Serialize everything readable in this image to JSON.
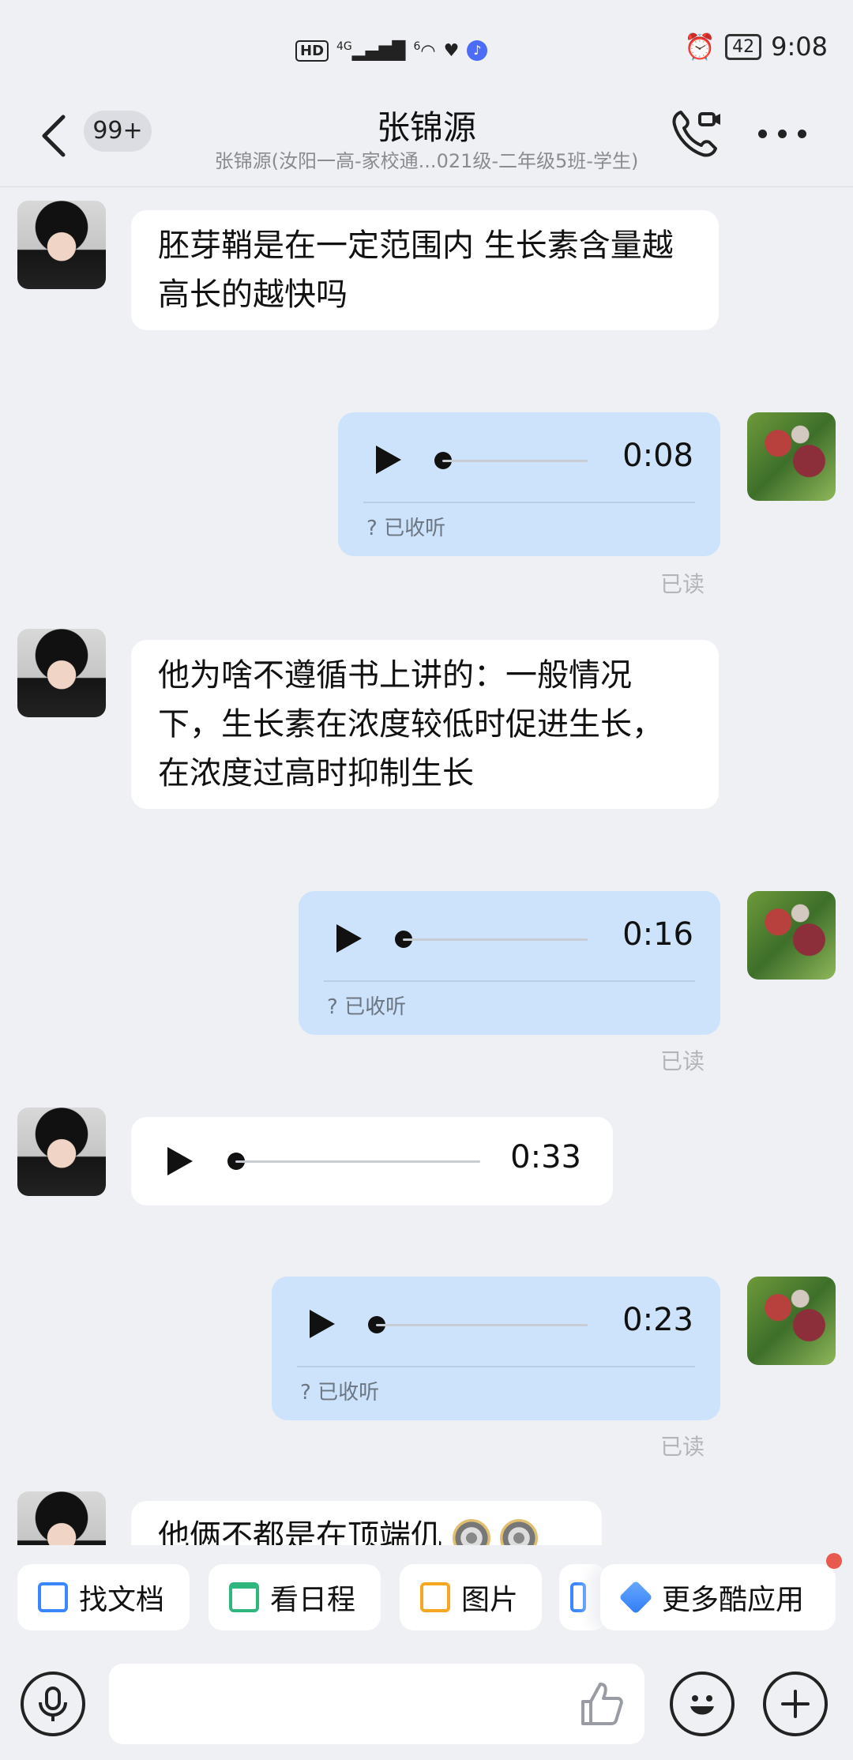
{
  "status_bar": {
    "hd": "HD",
    "net_4g": "4G",
    "net_6": "6",
    "battery": "42",
    "time": "9:08"
  },
  "header": {
    "unread_count": "99+",
    "contact_name": "张锦源",
    "contact_subtitle": "张锦源(汝阳一高-家校通...021级-二年级5班-学生)"
  },
  "messages": [
    {
      "side": "theirs",
      "type": "text",
      "text": "胚芽鞘是在一定范围内 生长素含量越高长的越快吗"
    },
    {
      "side": "mine",
      "type": "voice",
      "duration": "0:08",
      "listened_label": "已收听",
      "read_label": "已读"
    },
    {
      "side": "theirs",
      "type": "text",
      "text": "他为啥不遵循书上讲的：一般情况下，生长素在浓度较低时促进生长，在浓度过高时抑制生长"
    },
    {
      "side": "mine",
      "type": "voice",
      "duration": "0:16",
      "listened_label": "已收听",
      "read_label": "已读"
    },
    {
      "side": "theirs",
      "type": "voice",
      "duration": "0:33"
    },
    {
      "side": "mine",
      "type": "voice",
      "duration": "0:23",
      "listened_label": "已收听",
      "read_label": "已读"
    },
    {
      "side": "theirs",
      "type": "text",
      "text": "他俩不都是在顶端仉"
    }
  ],
  "quick_actions": [
    {
      "label": "找文档",
      "icon": "doc-search-icon",
      "color": "#3a86ff"
    },
    {
      "label": "看日程",
      "icon": "calendar-icon",
      "color": "#2fb67c"
    },
    {
      "label": "图片",
      "icon": "image-icon",
      "color": "#f5a623"
    },
    {
      "label": "更多酷应用",
      "icon": "apps-icon",
      "color": "#2f7cf6"
    }
  ],
  "colors": {
    "background": "#eff0f4",
    "my_bubble": "#cde3fb",
    "their_bubble": "#ffffff",
    "read_text": "#b3b5ba",
    "notification_dot": "#e85a4f"
  }
}
